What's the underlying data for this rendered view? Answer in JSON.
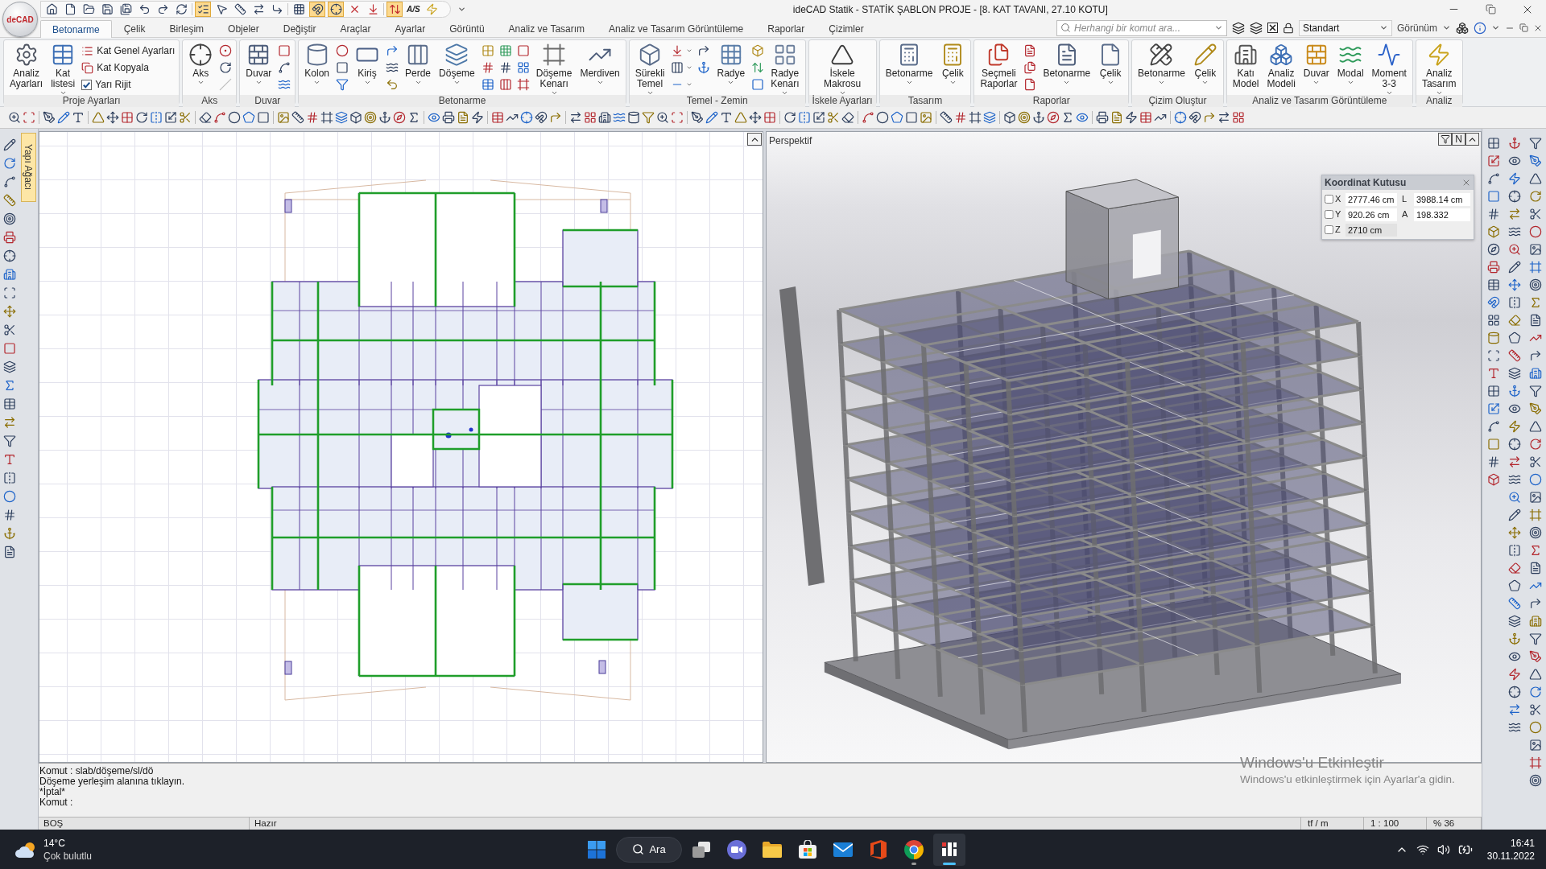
{
  "title_bar": {
    "logo_text": "deCAD",
    "quick_access": [
      {
        "on": false
      },
      {
        "on": false
      },
      {
        "on": false
      },
      {
        "on": false
      },
      {
        "on": false
      },
      {
        "on": false
      },
      {
        "on": false
      },
      {
        "on": false
      },
      {
        "on": true
      },
      {
        "on": false
      },
      {
        "on": false
      },
      {
        "on": false
      },
      {
        "on": false
      },
      {
        "on": false
      },
      {
        "on": true
      },
      {
        "on": true
      },
      {
        "on": false
      },
      {
        "on": false
      },
      {
        "on": true
      },
      {
        "on": false,
        "label": "A/S"
      },
      {
        "on": false
      }
    ],
    "title": "ideCAD Statik - STATİK ŞABLON PROJE - [8. KAT TAVANI, 27.10 KOTU]"
  },
  "ribbon": {
    "tabs": [
      {
        "label": "Betonarme",
        "selected": true
      },
      {
        "label": "Çelik",
        "selected": false
      },
      {
        "label": "Birleşim",
        "selected": false
      },
      {
        "label": "Objeler",
        "selected": false
      },
      {
        "label": "Değiştir",
        "selected": false
      },
      {
        "label": "Araçlar",
        "selected": false
      },
      {
        "label": "Ayarlar",
        "selected": false
      },
      {
        "label": "Görüntü",
        "selected": false
      },
      {
        "label": "Analiz ve Tasarım",
        "selected": false
      },
      {
        "label": "Analiz ve Tasarım Görüntüleme",
        "selected": false
      },
      {
        "label": "Raporlar",
        "selected": false
      },
      {
        "label": "Çizimler",
        "selected": false
      }
    ],
    "search": {
      "placeholder": "Herhangi bir komut ara..."
    },
    "style_select": {
      "value": "Standart"
    },
    "view_menu": {
      "label": "Görünüm"
    },
    "groups": [
      {
        "label": "Proje Ayarları",
        "items": [
          {
            "kind": "large",
            "label": "Analiz Ayarları",
            "menu": false,
            "disabled": false
          },
          {
            "kind": "large",
            "label": "Kat listesi",
            "menu": true,
            "disabled": false
          },
          {
            "kind": "small",
            "label": "Kat Genel Ayarları",
            "menu": false,
            "disabled": false
          },
          {
            "kind": "small",
            "label": "Kat Kopyala",
            "menu": false,
            "disabled": false
          },
          {
            "kind": "check",
            "label": "Yarı Rijit",
            "checked": true,
            "menu": false,
            "disabled": false
          }
        ]
      },
      {
        "label": "Aks",
        "items": [
          {
            "kind": "large",
            "label": "Aks",
            "menu": true,
            "disabled": false
          },
          {
            "kind": "small",
            "menu": false,
            "disabled": false
          },
          {
            "kind": "small",
            "menu": false,
            "disabled": false
          },
          {
            "kind": "small",
            "menu": false,
            "disabled": true
          }
        ]
      },
      {
        "label": "Duvar",
        "items": [
          {
            "kind": "large",
            "label": "Duvar",
            "menu": true,
            "disabled": false
          },
          {
            "kind": "small",
            "menu": false,
            "disabled": false
          },
          {
            "kind": "small",
            "menu": false,
            "disabled": false
          },
          {
            "kind": "small",
            "menu": false,
            "disabled": false
          }
        ]
      },
      {
        "label": "Betonarme",
        "items": [
          {
            "kind": "large",
            "label": "Kolon",
            "menu": true,
            "disabled": false
          },
          {
            "kind": "small",
            "menu": false,
            "disabled": false
          },
          {
            "kind": "small",
            "menu": false,
            "disabled": false
          },
          {
            "kind": "small",
            "menu": false,
            "disabled": false
          },
          {
            "kind": "large",
            "label": "Kiriş",
            "menu": true,
            "disabled": false
          },
          {
            "kind": "small",
            "menu": false,
            "disabled": false
          },
          {
            "kind": "small",
            "menu": false,
            "disabled": false
          },
          {
            "kind": "small",
            "menu": false,
            "disabled": false
          },
          {
            "kind": "large",
            "label": "Perde",
            "menu": true,
            "disabled": false
          },
          {
            "kind": "large",
            "label": "Döşeme",
            "menu": true,
            "disabled": false
          },
          {
            "kind": "small",
            "menu": false,
            "disabled": false
          },
          {
            "kind": "small",
            "menu": false,
            "disabled": false
          },
          {
            "kind": "small",
            "menu": false,
            "disabled": false
          },
          {
            "kind": "small",
            "menu": false,
            "disabled": false
          },
          {
            "kind": "small",
            "menu": false,
            "disabled": false
          },
          {
            "kind": "small",
            "menu": false,
            "disabled": false
          },
          {
            "kind": "small",
            "menu": false,
            "disabled": false
          },
          {
            "kind": "small",
            "menu": false,
            "disabled": false
          },
          {
            "kind": "small",
            "menu": false,
            "disabled": false
          },
          {
            "kind": "large",
            "label": "Döşeme Kenarı",
            "menu": true,
            "disabled": false
          },
          {
            "kind": "large",
            "label": "Merdiven",
            "menu": true,
            "disabled": false
          }
        ]
      },
      {
        "label": "Temel - Zemin",
        "items": [
          {
            "kind": "large",
            "label": "Sürekli Temel",
            "menu": true,
            "disabled": false
          },
          {
            "kind": "small",
            "menu": true,
            "disabled": false
          },
          {
            "kind": "small",
            "menu": true,
            "disabled": false
          },
          {
            "kind": "small",
            "menu": true,
            "disabled": false
          },
          {
            "kind": "small",
            "menu": false,
            "disabled": false
          },
          {
            "kind": "small",
            "menu": false,
            "disabled": false
          },
          {
            "kind": "large",
            "label": "Radye",
            "menu": true,
            "disabled": false
          },
          {
            "kind": "small",
            "menu": false,
            "disabled": false
          },
          {
            "kind": "small",
            "menu": false,
            "disabled": false
          },
          {
            "kind": "small",
            "menu": false,
            "disabled": false
          },
          {
            "kind": "large",
            "label": "Radye Kenarı",
            "menu": true,
            "disabled": false
          }
        ]
      },
      {
        "label": "İskele Ayarları",
        "items": [
          {
            "kind": "large",
            "label": "İskele Makrosu",
            "menu": true,
            "disabled": false
          }
        ]
      },
      {
        "label": "Tasarım",
        "items": [
          {
            "kind": "large",
            "label": "Betonarme",
            "menu": true,
            "disabled": false
          },
          {
            "kind": "large",
            "label": "Çelik",
            "menu": true,
            "disabled": false
          }
        ]
      },
      {
        "label": "Raporlar",
        "items": [
          {
            "kind": "large",
            "label": "Seçmeli Raporlar",
            "menu": false,
            "disabled": false
          },
          {
            "kind": "small",
            "menu": false,
            "disabled": false
          },
          {
            "kind": "small",
            "menu": false,
            "disabled": false
          },
          {
            "kind": "small",
            "menu": false,
            "disabled": false
          },
          {
            "kind": "large",
            "label": "Betonarme",
            "menu": true,
            "disabled": false
          },
          {
            "kind": "large",
            "label": "Çelik",
            "menu": true,
            "disabled": false
          }
        ]
      },
      {
        "label": "Çizim Oluştur",
        "items": [
          {
            "kind": "large",
            "label": "Betonarme",
            "menu": true,
            "disabled": false
          },
          {
            "kind": "large",
            "label": "Çelik",
            "menu": true,
            "disabled": false
          }
        ]
      },
      {
        "label": "Analiz ve Tasarım Görüntüleme",
        "items": [
          {
            "kind": "large",
            "label": "Katı Model",
            "menu": false,
            "disabled": false
          },
          {
            "kind": "large",
            "label": "Analiz Modeli",
            "menu": false,
            "disabled": false
          },
          {
            "kind": "large",
            "label": "Duvar",
            "menu": true,
            "disabled": false
          },
          {
            "kind": "large",
            "label": "Modal",
            "menu": true,
            "disabled": false
          },
          {
            "kind": "large",
            "label": "Moment 3-3",
            "menu": true,
            "disabled": false
          }
        ]
      },
      {
        "label": "Analiz",
        "items": [
          {
            "kind": "large",
            "label": "Analiz Tasarım",
            "menu": true,
            "disabled": false
          }
        ]
      }
    ]
  },
  "side_panel_tab": {
    "label": "Yapı Ağacı"
  },
  "perspective_view": {
    "label": "Perspektif",
    "mode_button": {
      "label": "N"
    }
  },
  "coordinate_box": {
    "title": "Koordinat Kutusu",
    "rows": [
      {
        "axis": "X",
        "checked": false,
        "value": "2777.46 cm",
        "disabled": false,
        "extra_label": "L",
        "extra_value": "3988.14 cm"
      },
      {
        "axis": "Y",
        "checked": false,
        "value": "920.26 cm",
        "disabled": false,
        "extra_label": "A",
        "extra_value": "198.332"
      },
      {
        "axis": "Z",
        "checked": false,
        "value": "2710 cm",
        "disabled": true
      }
    ]
  },
  "command_log": {
    "lines": [
      "Komut : slab/döşeme/sl/dö",
      "Döşeme yerleşim alanına tıklayın.",
      "*İptal*",
      "Komut :"
    ]
  },
  "status_bar": {
    "left_fields": [
      "BOŞ",
      "Hazır"
    ],
    "right_fields": [
      "tf / m",
      "1 : 100",
      "% 36"
    ]
  },
  "activation_notice": {
    "title": "Windows'u Etkinleştir",
    "message": "Windows'u etkinleştirmek için Ayarlar'a gidin."
  },
  "taskbar": {
    "weather": {
      "temperature": "14°C",
      "condition": "Çok bulutlu"
    },
    "search": {
      "label": "Ara"
    },
    "apps": [
      {
        "running": false,
        "active": false
      },
      {
        "running": false,
        "active": false
      },
      {
        "running": false,
        "active": false
      },
      {
        "running": false,
        "active": false
      },
      {
        "running": false,
        "active": false
      },
      {
        "running": false,
        "active": false
      },
      {
        "running": true,
        "active": false
      },
      {
        "running": true,
        "active": true
      }
    ],
    "clock": {
      "time": "16:41",
      "date": "30.11.2022"
    }
  }
}
